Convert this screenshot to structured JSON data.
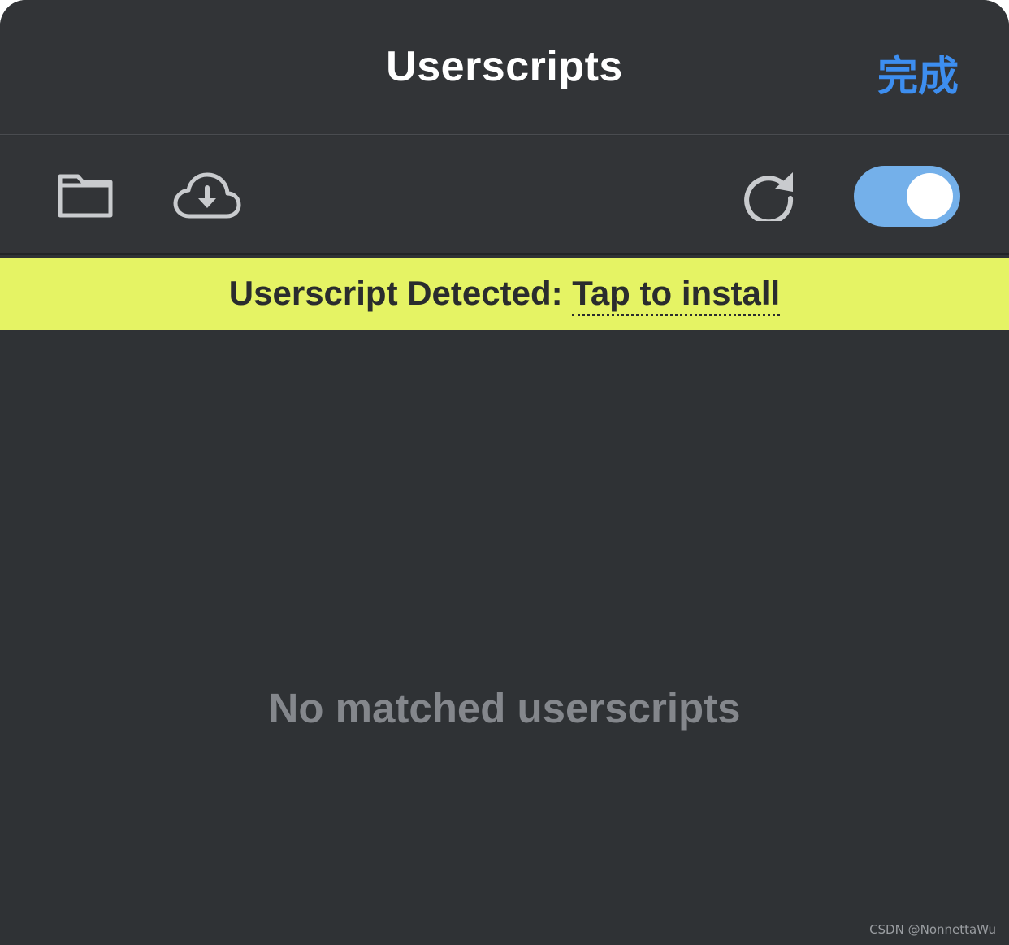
{
  "colors": {
    "accent": "#3d8ef0",
    "toggle_on": "#74b0ea",
    "banner_bg": "#e5f364",
    "background": "#2f3235",
    "icon": "#c9cbce",
    "muted_text": "#84878c"
  },
  "navbar": {
    "title": "Userscripts",
    "done_label": "完成"
  },
  "toolbar": {
    "icons": [
      "folder-icon",
      "cloud-download-icon",
      "refresh-icon"
    ],
    "toggle_state": "on"
  },
  "banner": {
    "prefix": "Userscript Detected: ",
    "link": "Tap to install"
  },
  "empty_state": {
    "message": "No matched userscripts"
  },
  "watermark": {
    "text": "CSDN @NonnettaWu"
  }
}
